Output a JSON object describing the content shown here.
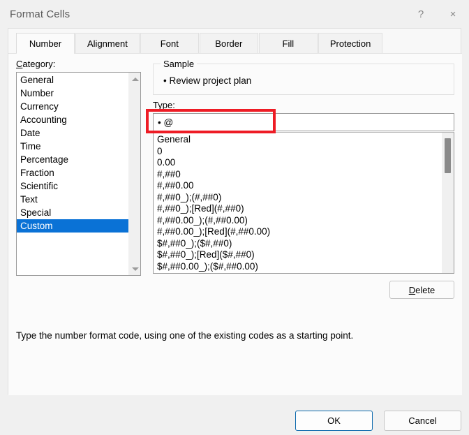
{
  "window": {
    "title": "Format Cells",
    "help_icon": "?",
    "close_icon": "×"
  },
  "tabs": [
    {
      "label": "Number",
      "active": true
    },
    {
      "label": "Alignment",
      "active": false
    },
    {
      "label": "Font",
      "active": false
    },
    {
      "label": "Border",
      "active": false
    },
    {
      "label": "Fill",
      "active": false
    },
    {
      "label": "Protection",
      "active": false
    }
  ],
  "category": {
    "label": "Category:",
    "label_accel": "C",
    "items": [
      "General",
      "Number",
      "Currency",
      "Accounting",
      "Date",
      "Time",
      "Percentage",
      "Fraction",
      "Scientific",
      "Text",
      "Special",
      "Custom"
    ],
    "selected": "Custom",
    "selected_index": 11,
    "scroll_up_icon": "triangle-up",
    "scroll_down_icon": "triangle-down"
  },
  "sample": {
    "legend": "Sample",
    "value": "• Review project plan"
  },
  "type": {
    "label": "Type:",
    "label_accel": "T",
    "input_value": "• @",
    "placeholder": "",
    "items": [
      "General",
      "0",
      "0.00",
      "#,##0",
      "#,##0.00",
      "#,##0_);(#,##0)",
      "#,##0_);[Red](#,##0)",
      "#,##0.00_);(#,##0.00)",
      "#,##0.00_);[Red](#,##0.00)",
      "$#,##0_);($#,##0)",
      "$#,##0_);[Red]($#,##0)",
      "$#,##0.00_);($#,##0.00)"
    ]
  },
  "buttons": {
    "delete": "Delete",
    "delete_accel": "D",
    "ok": "OK",
    "cancel": "Cancel"
  },
  "help_text": "Type the number format code, using one of the existing codes as a starting point.",
  "colors": {
    "accent": "#0a72d6",
    "annotation": "#ee1c25",
    "default_button_border": "#0d6aad",
    "dialog_bg": "#f0f0f0",
    "panel_bg": "#fbfbfb"
  }
}
